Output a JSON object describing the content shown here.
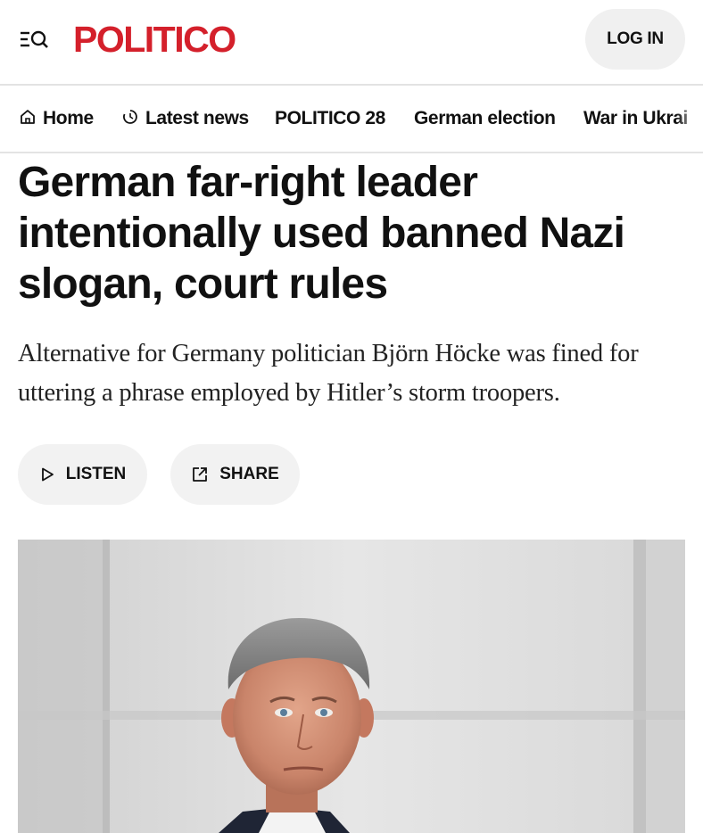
{
  "header": {
    "logo_text": "POLITICO",
    "login_label": "LOG IN",
    "menu_icon": "menu-search-icon",
    "brand_color": "#d4202b"
  },
  "nav": {
    "items": [
      {
        "label": "Home",
        "icon": "home-icon"
      },
      {
        "label": "Latest news",
        "icon": "clock-icon"
      },
      {
        "label": "POLITICO 28"
      },
      {
        "label": "German election"
      },
      {
        "label": "War in Ukrai"
      }
    ]
  },
  "article": {
    "headline": "German far-right leader intentionally used banned Nazi slogan, court rules",
    "dek": "Alternative for Germany politician Björn Höcke was fined for uttering a phrase employed by Hitler’s storm troopers.",
    "actions": {
      "listen_label": "LISTEN",
      "share_label": "SHARE"
    }
  }
}
